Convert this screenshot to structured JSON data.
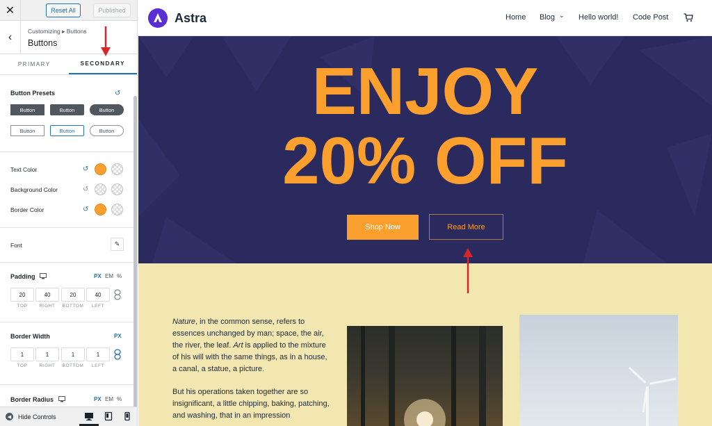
{
  "sidebar": {
    "close_icon": "close-icon",
    "reset_all": "Reset All",
    "published": "Published",
    "breadcrumb": "Customizing ▸ Buttons",
    "section_title": "Buttons",
    "tabs": [
      "PRIMARY",
      "SECONDARY"
    ],
    "active_tab": "SECONDARY",
    "button_presets": {
      "title": "Button Presets",
      "filled": [
        "Button",
        "Button",
        "Button"
      ],
      "outline": [
        "Button",
        "Button",
        "Button"
      ]
    },
    "colors": {
      "text_color": "Text Color",
      "background_color": "Background Color",
      "border_color": "Border Color",
      "accent": "#fb9f2e"
    },
    "font": "Font",
    "padding": {
      "title": "Padding",
      "units": [
        "PX",
        "EM",
        "%"
      ],
      "values": [
        "20",
        "40",
        "20",
        "40"
      ],
      "captions": [
        "TOP",
        "RIGHT",
        "BOTTOM",
        "LEFT"
      ]
    },
    "border_width": {
      "title": "Border Width",
      "unit": "PX",
      "values": [
        "1",
        "1",
        "1",
        "1"
      ],
      "captions": [
        "TOP",
        "RIGHT",
        "BOTTOM",
        "LEFT"
      ]
    },
    "border_radius": {
      "title": "Border Radius",
      "units": [
        "PX",
        "EM",
        "%"
      ]
    },
    "footer": {
      "hide_controls": "Hide Controls"
    }
  },
  "preview": {
    "site_name": "Astra",
    "nav": [
      "Home",
      "Blog",
      "Hello world!",
      "Code Post"
    ],
    "hero": {
      "line1": "ENJOY",
      "line2": "20% OFF",
      "primary_button": "Shop Now",
      "secondary_button": "Read More",
      "background": "#2b2a5e",
      "accent": "#fb9f2e"
    },
    "paragraph1": {
      "em1": "Nature",
      "t1": ", in the common sense, refers to essences unchanged by man; space, the air, the river, the leaf. ",
      "em2": "Art",
      "t2": " is applied to the mixture of his will with the same things, as in a house, a canal, a statue, a picture."
    },
    "paragraph2": "But his operations taken together are so insignificant, a little chipping, baking, patching, and washing, that in an impression"
  }
}
